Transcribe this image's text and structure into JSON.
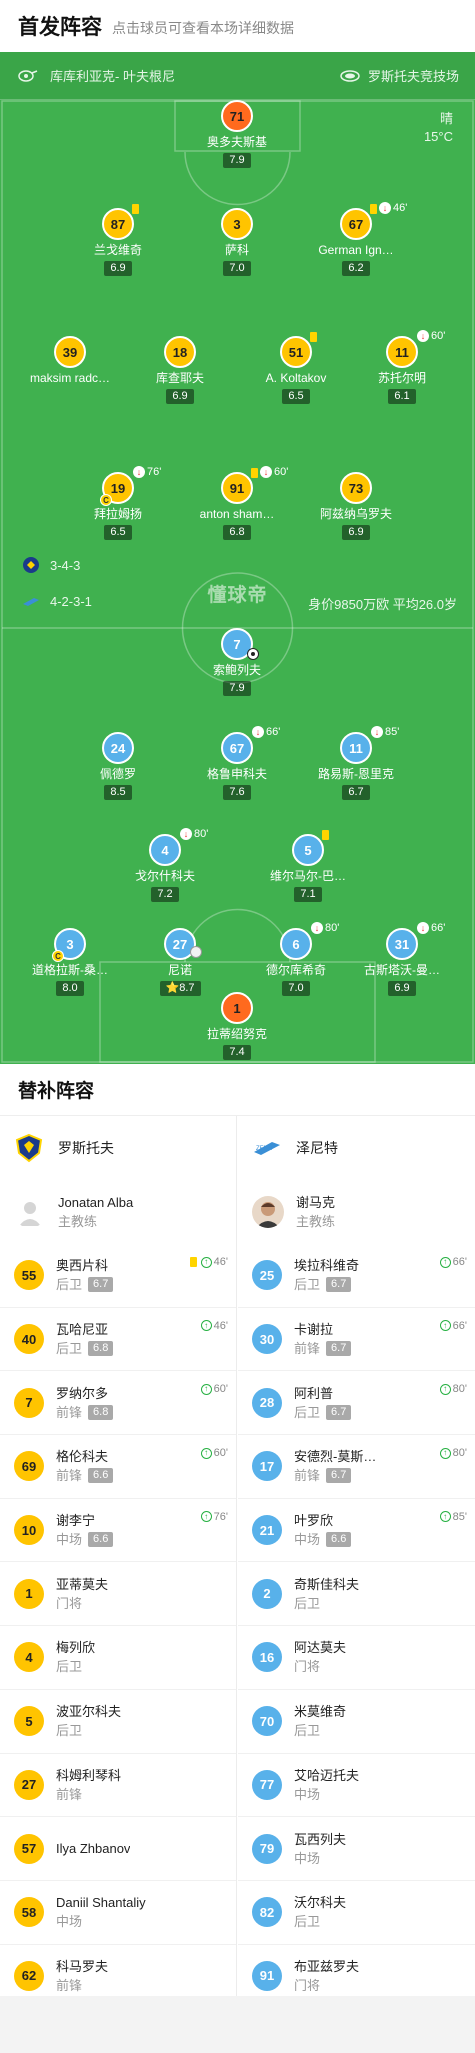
{
  "header": {
    "title": "首发阵容",
    "subtitle": "点击球员可查看本场详细数据"
  },
  "venue": {
    "home_team": "库库利亚克- 叶夫根尼",
    "away_team": "罗斯托夫竞技场"
  },
  "weather": {
    "condition": "晴",
    "temp": "15°C"
  },
  "home_formation": "3-4-3",
  "away_formation": "4-2-3-1",
  "squad_value": "身价9850万欧 平均26.0岁",
  "watermark": "懂球帝",
  "pitch_players": [
    {
      "num": "71",
      "name": "奥多夫斯基",
      "rating": "7.9",
      "team": "home",
      "gk": true
    },
    {
      "num": "87",
      "name": "兰戈维奇",
      "rating": "6.9",
      "team": "home",
      "card": "yellow"
    },
    {
      "num": "3",
      "name": "萨科",
      "rating": "7.0",
      "team": "home"
    },
    {
      "num": "67",
      "name": "German Ign…",
      "rating": "6.2",
      "team": "home",
      "card": "yellow",
      "sub": "46'"
    },
    {
      "num": "39",
      "name": "maksim radc…",
      "rating": "",
      "team": "home"
    },
    {
      "num": "18",
      "name": "库查耶夫",
      "rating": "6.9",
      "team": "home"
    },
    {
      "num": "51",
      "name": "A. Koltakov",
      "rating": "6.5",
      "team": "home",
      "card": "yellow"
    },
    {
      "num": "11",
      "name": "苏托尔明",
      "rating": "6.1",
      "team": "home",
      "sub": "60'"
    },
    {
      "num": "19",
      "name": "拜拉姆扬",
      "rating": "6.5",
      "team": "home",
      "sub": "76'",
      "captain": true
    },
    {
      "num": "91",
      "name": "anton sham…",
      "rating": "6.8",
      "team": "home",
      "card": "yellow",
      "sub": "60'"
    },
    {
      "num": "73",
      "name": "阿兹纳乌罗夫",
      "rating": "6.9",
      "team": "home"
    },
    {
      "num": "7",
      "name": "索鲍列夫",
      "rating": "7.9",
      "team": "away",
      "goal": true
    },
    {
      "num": "24",
      "name": "佩德罗",
      "rating": "8.5",
      "team": "away"
    },
    {
      "num": "67",
      "name": "格鲁申科夫",
      "rating": "7.6",
      "team": "away",
      "sub": "66'"
    },
    {
      "num": "11",
      "name": "路易斯-恩里克",
      "rating": "6.7",
      "team": "away",
      "sub": "85'"
    },
    {
      "num": "4",
      "name": "戈尔什科夫",
      "rating": "7.2",
      "team": "away",
      "sub": "80'"
    },
    {
      "num": "5",
      "name": "维尔马尔-巴…",
      "rating": "7.1",
      "team": "away",
      "card": "yellow"
    },
    {
      "num": "3",
      "name": "道格拉斯-桑…",
      "rating": "8.0",
      "team": "away",
      "captain": true
    },
    {
      "num": "27",
      "name": "尼诺",
      "rating": "8.7",
      "team": "away",
      "best": true
    },
    {
      "num": "6",
      "name": "德尔库希奇",
      "rating": "7.0",
      "team": "away",
      "sub": "80'"
    },
    {
      "num": "31",
      "name": "古斯塔沃-曼…",
      "rating": "6.9",
      "team": "away",
      "sub": "66'"
    },
    {
      "num": "1",
      "name": "拉蒂绍努克",
      "rating": "7.4",
      "team": "away",
      "gk": true
    }
  ],
  "subs_title": "替补阵容",
  "home_team": {
    "name": "罗斯托夫",
    "coach": "Jonatan Alba",
    "coach_role": "主教练",
    "subs": [
      {
        "num": "55",
        "name": "奥西片科",
        "pos": "后卫",
        "rating": "6.7",
        "card": "yellow",
        "in": "46'"
      },
      {
        "num": "40",
        "name": "瓦哈尼亚",
        "pos": "后卫",
        "rating": "6.8",
        "in": "46'"
      },
      {
        "num": "7",
        "name": "罗纳尔多",
        "pos": "前锋",
        "rating": "6.8",
        "in": "60'"
      },
      {
        "num": "69",
        "name": "格伦科夫",
        "pos": "前锋",
        "rating": "6.6",
        "in": "60'"
      },
      {
        "num": "10",
        "name": "谢李宁",
        "pos": "中场",
        "rating": "6.6",
        "in": "76'"
      },
      {
        "num": "1",
        "name": "亚蒂莫夫",
        "pos": "门将",
        "rating": ""
      },
      {
        "num": "4",
        "name": "梅列欣",
        "pos": "后卫",
        "rating": ""
      },
      {
        "num": "5",
        "name": "波亚尔科夫",
        "pos": "后卫",
        "rating": ""
      },
      {
        "num": "27",
        "name": "科姆利琴科",
        "pos": "前锋",
        "rating": ""
      },
      {
        "num": "57",
        "name": "Ilya Zhbanov",
        "pos": "",
        "rating": ""
      },
      {
        "num": "58",
        "name": "Daniil Shantaliy",
        "pos": "中场",
        "rating": ""
      },
      {
        "num": "62",
        "name": "科马罗夫",
        "pos": "前锋",
        "rating": ""
      }
    ]
  },
  "away_team": {
    "name": "泽尼特",
    "coach": "谢马克",
    "coach_role": "主教练",
    "subs": [
      {
        "num": "25",
        "name": "埃拉科维奇",
        "pos": "后卫",
        "rating": "6.7",
        "in": "66'"
      },
      {
        "num": "30",
        "name": "卡谢拉",
        "pos": "前锋",
        "rating": "6.7",
        "in": "66'"
      },
      {
        "num": "28",
        "name": "阿利普",
        "pos": "后卫",
        "rating": "6.7",
        "in": "80'"
      },
      {
        "num": "17",
        "name": "安德烈-莫斯…",
        "pos": "前锋",
        "rating": "6.7",
        "in": "80'"
      },
      {
        "num": "21",
        "name": "叶罗欣",
        "pos": "中场",
        "rating": "6.6",
        "in": "85'"
      },
      {
        "num": "2",
        "name": "奇斯佳科夫",
        "pos": "后卫",
        "rating": ""
      },
      {
        "num": "16",
        "name": "阿达莫夫",
        "pos": "门将",
        "rating": ""
      },
      {
        "num": "70",
        "name": "米莫维奇",
        "pos": "后卫",
        "rating": ""
      },
      {
        "num": "77",
        "name": "艾哈迈托夫",
        "pos": "中场",
        "rating": ""
      },
      {
        "num": "79",
        "name": "瓦西列夫",
        "pos": "中场",
        "rating": ""
      },
      {
        "num": "82",
        "name": "沃尔科夫",
        "pos": "后卫",
        "rating": ""
      },
      {
        "num": "91",
        "name": "布亚兹罗夫",
        "pos": "门将",
        "rating": ""
      }
    ]
  },
  "colors": {
    "pitch": "#40b14f",
    "home": "#ffc400",
    "away": "#58b1ea",
    "gk_home": "#ff6a1e"
  }
}
